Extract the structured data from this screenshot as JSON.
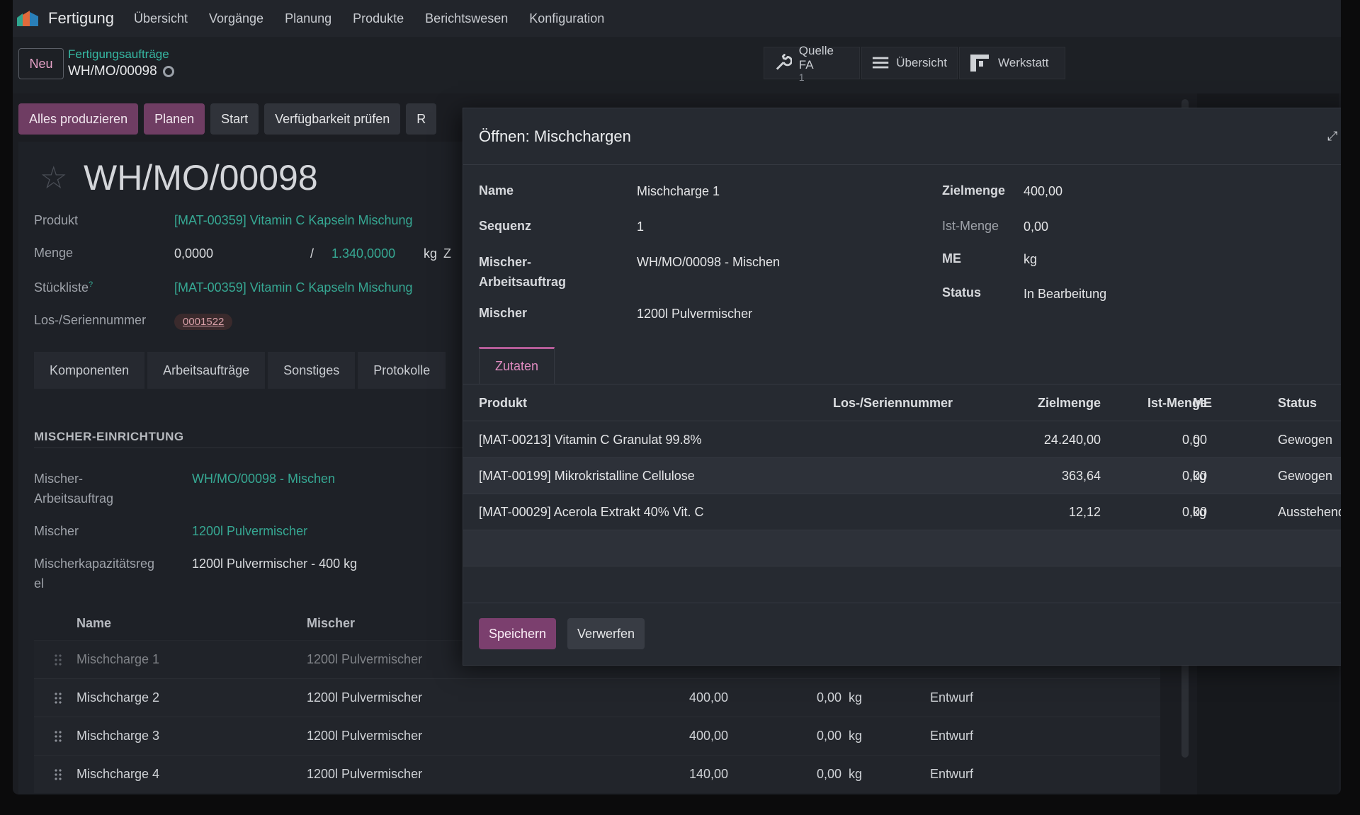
{
  "navbar": {
    "app_name": "Fertigung",
    "menu": [
      "Übersicht",
      "Vorgänge",
      "Planung",
      "Produkte",
      "Berichtswesen",
      "Konfiguration"
    ]
  },
  "control": {
    "new_label": "Neu",
    "breadcrumb_parent": "Fertigungsaufträge",
    "breadcrumb_current": "WH/MO/00098",
    "smart_buttons": {
      "source": {
        "label": "Quelle FA",
        "count": "1"
      },
      "overview": {
        "label": "Übersicht"
      },
      "workshop": {
        "label": "Werkstatt"
      }
    }
  },
  "actions": {
    "produce_all": "Alles produzieren",
    "plan": "Planen",
    "start": "Start",
    "check_availability": "Verfügbarkeit prüfen",
    "more_partial": "R"
  },
  "form": {
    "title": "WH/MO/00098",
    "product_label": "Produkt",
    "product_value": "[MAT-00359] Vitamin C Kapseln Mischung",
    "qty_label": "Menge",
    "qty_done": "0,0000",
    "qty_sep": "/",
    "qty_target": "1.340,0000",
    "qty_uom": "kg",
    "qty_more": "Z",
    "bom_label": "Stückliste",
    "bom_help": "?",
    "bom_value": "[MAT-00359] Vitamin C Kapseln Mischung",
    "lot_label": "Los-/Seriennummer",
    "lot_value": "0001522",
    "tabs": [
      "Komponenten",
      "Arbeitsaufträge",
      "Sonstiges",
      "Protokolle"
    ],
    "mixer_section": {
      "title": "MISCHER-EINRICHTUNG",
      "workorder_label": "Mischer-\nArbeitsauftrag",
      "workorder_value": "WH/MO/00098 - Mischen",
      "mixer_label": "Mischer",
      "mixer_value": "1200l Pulvermischer",
      "capacity_label": "Mischerkapazitätsreg\nel",
      "capacity_value": "1200l Pulvermischer - 400 kg"
    },
    "batch_columns": {
      "name": "Name",
      "mixer": "Mischer"
    },
    "batches": [
      {
        "name": "Mischcharge 1",
        "mixer": "1200l Pulvermischer",
        "target": "",
        "actual": "",
        "uom": "",
        "status": ""
      },
      {
        "name": "Mischcharge 2",
        "mixer": "1200l Pulvermischer",
        "target": "400,00",
        "actual": "0,00",
        "uom": "kg",
        "status": "Entwurf"
      },
      {
        "name": "Mischcharge 3",
        "mixer": "1200l Pulvermischer",
        "target": "400,00",
        "actual": "0,00",
        "uom": "kg",
        "status": "Entwurf"
      },
      {
        "name": "Mischcharge 4",
        "mixer": "1200l Pulvermischer",
        "target": "140,00",
        "actual": "0,00",
        "uom": "kg",
        "status": "Entwurf"
      }
    ]
  },
  "modal": {
    "title": "Öffnen: Mischchargen",
    "fields": {
      "name_label": "Name",
      "name_value": "Mischcharge 1",
      "seq_label": "Sequenz",
      "seq_value": "1",
      "workorder_label": "Mischer-\nArbeitsauftrag",
      "workorder_value": "WH/MO/00098 - Mischen",
      "mixer_label": "Mischer",
      "mixer_value": "1200l Pulvermischer",
      "target_label": "Zielmenge",
      "target_value": "400,00",
      "actual_label": "Ist-Menge",
      "actual_value": "0,00",
      "uom_label": "ME",
      "uom_value": "kg",
      "status_label": "Status",
      "status_value": "In Bearbeitung"
    },
    "tab": "Zutaten",
    "columns": {
      "product": "Produkt",
      "lot": "Los-/Seriennummer",
      "target": "Zielmenge",
      "actual": "Ist-Menge",
      "uom": "ME",
      "status": "Status"
    },
    "rows": [
      {
        "product": "[MAT-00213] Vitamin C Granulat 99.8%",
        "lot": "",
        "target": "24.240,00",
        "actual": "0,00",
        "uom": "g",
        "status": "Gewogen"
      },
      {
        "product": "[MAT-00199] Mikrokristalline Cellulose",
        "lot": "",
        "target": "363,64",
        "actual": "0,00",
        "uom": "kg",
        "status": "Gewogen"
      },
      {
        "product": "[MAT-00029] Acerola Extrakt 40% Vit. C",
        "lot": "",
        "target": "12,12",
        "actual": "0,00",
        "uom": "kg",
        "status": "Ausstehend"
      }
    ],
    "save_label": "Speichern",
    "discard_label": "Verwerfen"
  },
  "colors": {
    "accent": "#7b3f6e",
    "link": "#36a893",
    "tab_active": "#e08bc0"
  }
}
